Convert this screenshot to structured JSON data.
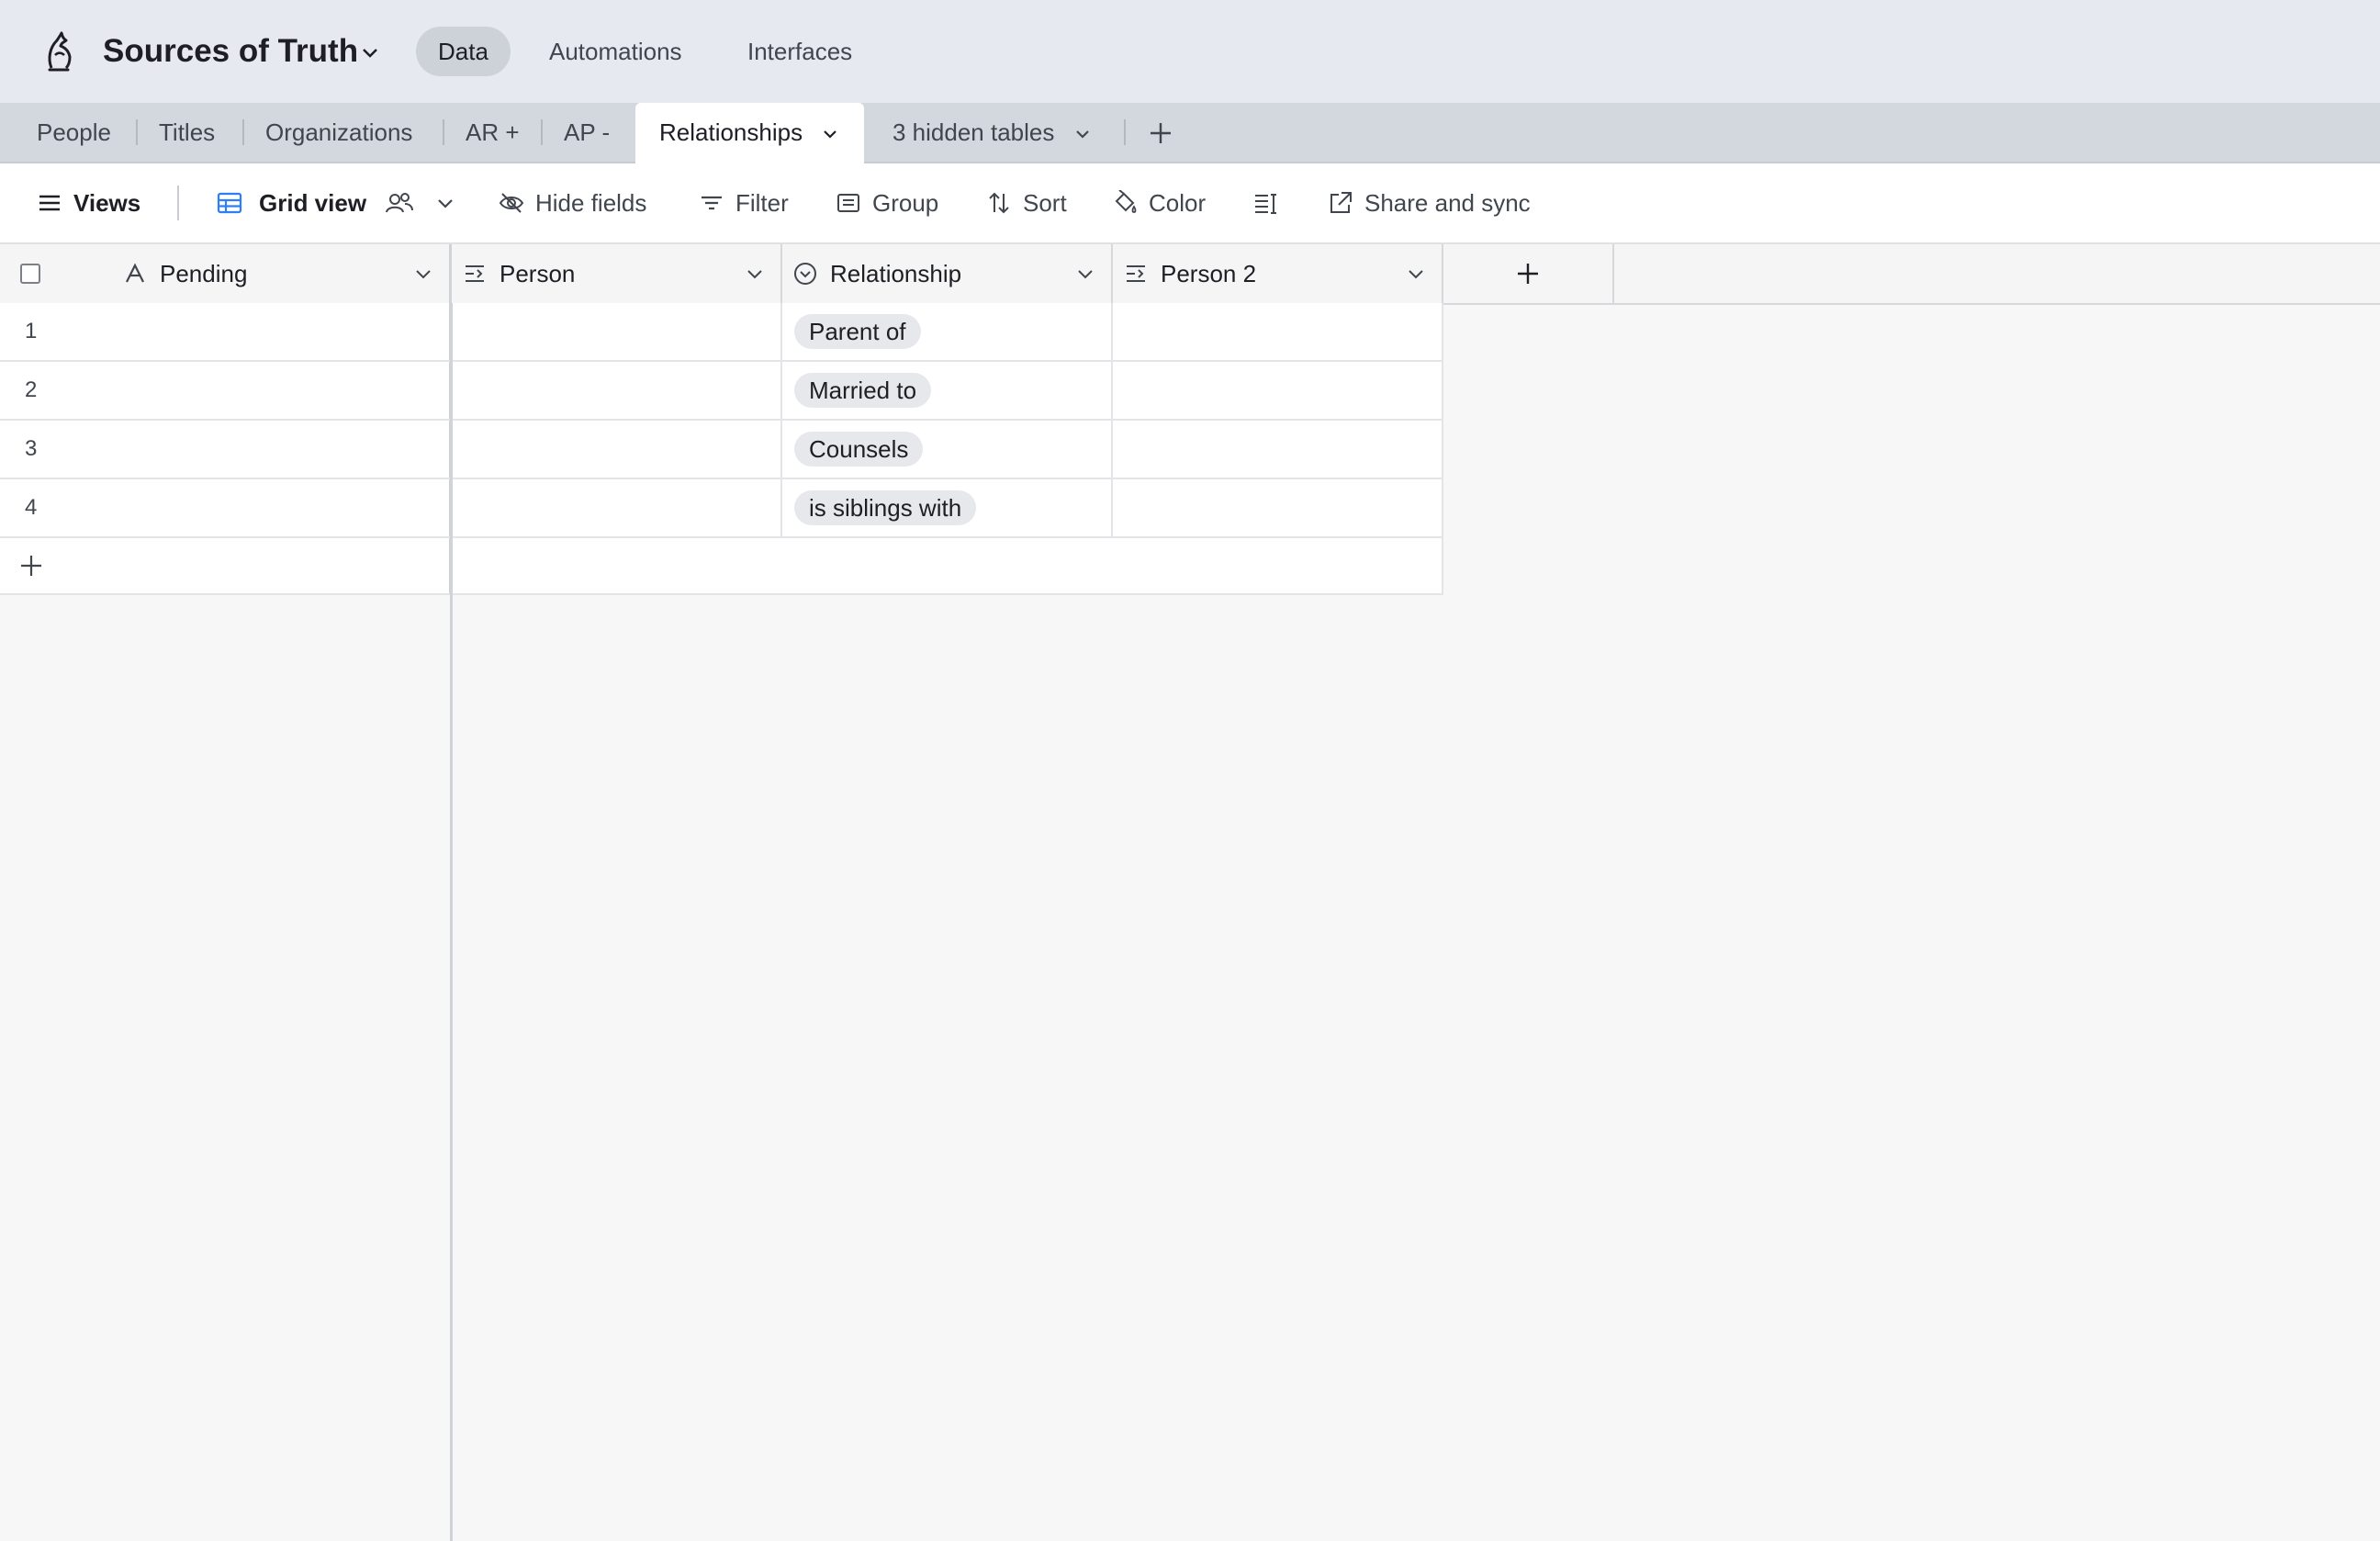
{
  "app": {
    "base_name": "Sources of Truth",
    "nav_tabs": [
      "Data",
      "Automations",
      "Interfaces"
    ],
    "active_nav": "Data"
  },
  "tables": {
    "tabs": [
      "People",
      "Titles",
      "Organizations",
      "AR +",
      "AP -"
    ],
    "active": "Relationships",
    "hidden": "3 hidden tables"
  },
  "toolbar": {
    "views": "Views",
    "view_name": "Grid view",
    "hide_fields": "Hide fields",
    "filter": "Filter",
    "group": "Group",
    "sort": "Sort",
    "color": "Color",
    "share": "Share and sync"
  },
  "grid": {
    "columns": [
      "Pending",
      "Person",
      "Relationship",
      "Person 2"
    ],
    "rows": [
      {
        "num": "1",
        "relationship": "Parent of"
      },
      {
        "num": "2",
        "relationship": "Married to"
      },
      {
        "num": "3",
        "relationship": "Counsels"
      },
      {
        "num": "4",
        "relationship": "is siblings with"
      }
    ]
  },
  "icons": {
    "logo": "chess-knight-logo-icon",
    "grid": "grid-view-icon",
    "collaborative": "people-icon"
  },
  "colors": {
    "app_bar": "#e6e9f0",
    "tab_bar": "#d3d7de",
    "accent_blue": "#2d7ff9",
    "pill": "#e6e8ec"
  }
}
